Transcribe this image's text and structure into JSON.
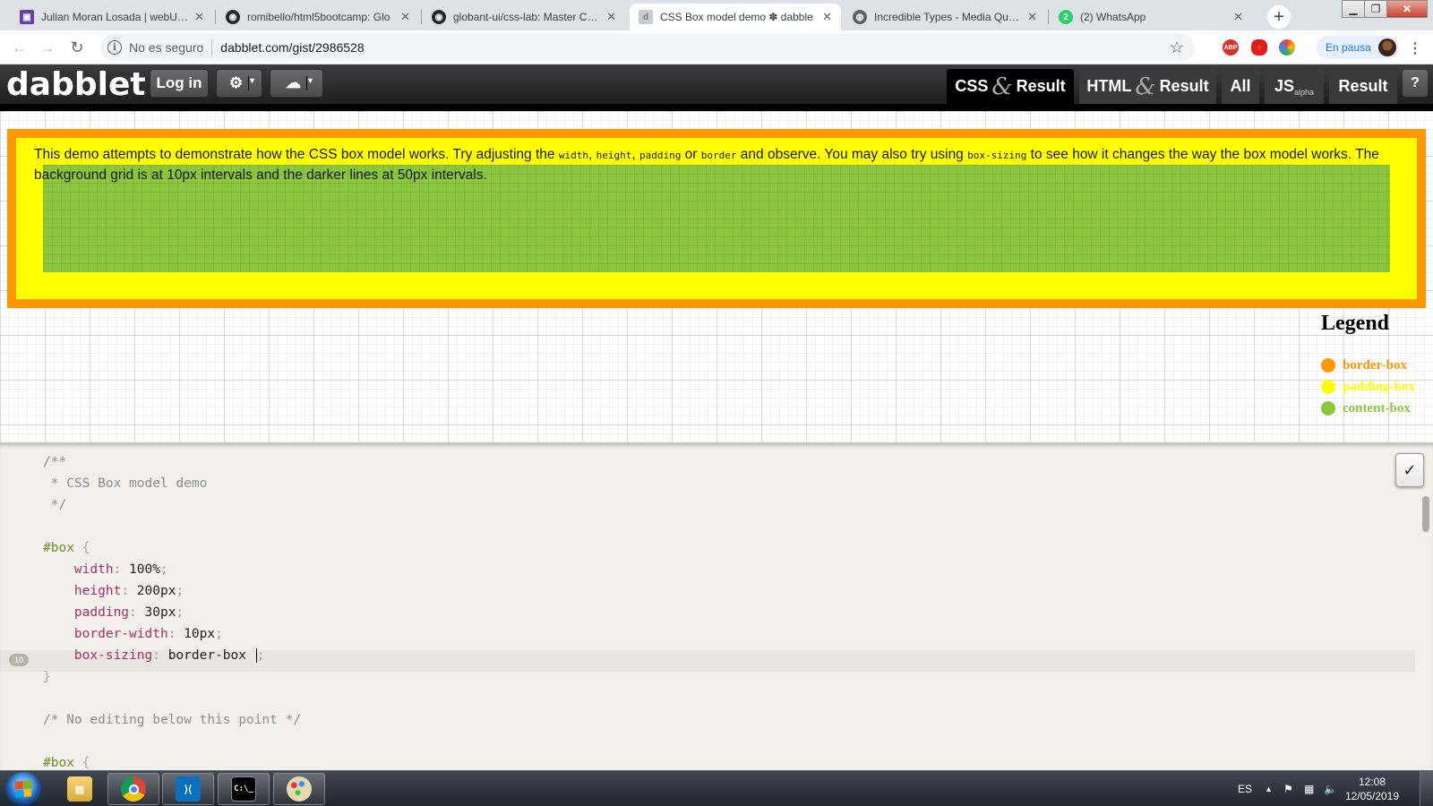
{
  "browser": {
    "tabs": [
      {
        "title": "Julian Moran Losada | webUIGL",
        "icon": "purple-square-icon"
      },
      {
        "title": "romibello/html5bootcamp: Glo",
        "icon": "github-icon"
      },
      {
        "title": "globant-ui/css-lab: Master CSS",
        "icon": "github-icon"
      },
      {
        "title": "CSS Box model demo ✽ dabble",
        "icon": "dabblet-icon"
      },
      {
        "title": "Incredible Types - Media Querie",
        "icon": "globe-icon"
      },
      {
        "title": "(2) WhatsApp",
        "icon": "whatsapp-icon"
      }
    ],
    "active_tab": 3,
    "security_label": "No es seguro",
    "url": "dabblet.com/gist/2986528",
    "profile_status": "En pausa",
    "extensions": [
      {
        "name": "adblock-plus-icon",
        "label": "ABP",
        "color": "#d9342b"
      },
      {
        "name": "opera-vpn-icon",
        "label": "",
        "color": "#e21b1b"
      },
      {
        "name": "color-picker-icon",
        "label": "",
        "color": "#f4a522"
      }
    ]
  },
  "dabblet": {
    "logo": "dabblet",
    "login_label": "Log in",
    "view_tabs": [
      {
        "main": "CSS",
        "amp": "&",
        "rest": "Result",
        "active": true
      },
      {
        "main": "HTML",
        "amp": "&",
        "rest": "Result",
        "active": false
      },
      {
        "main": "All",
        "amp": "",
        "rest": "",
        "active": false
      },
      {
        "main": "JS",
        "amp": "",
        "rest": "",
        "sub": "alpha",
        "active": false
      },
      {
        "main": "Result",
        "amp": "",
        "rest": "",
        "active": false
      }
    ],
    "help_label": "?"
  },
  "result": {
    "text": {
      "t1": "This demo attempts to demonstrate how the CSS box model works. Try adjusting the ",
      "c1": "width",
      "t2": ", ",
      "c2": "height",
      "t3": ", ",
      "c3": "padding",
      "t4": " or ",
      "c4": "border",
      "t5": " and observe. You may also try using ",
      "c5": "box-sizing",
      "t6": " to see how it changes the way the box model works. The background grid is at 10px intervals and the darker lines at 50px intervals."
    },
    "legend": {
      "title": "Legend",
      "items": [
        {
          "label": "border-box",
          "color": "#ff9800"
        },
        {
          "label": "padding-box",
          "color": "#ffff00"
        },
        {
          "label": "content-box",
          "color": "#8cc63f"
        }
      ]
    }
  },
  "editor": {
    "lines": {
      "l1": "/**",
      "l2": " * CSS Box model demo",
      "l3": " */",
      "l5_sel": "#box",
      "l5_brace": " {",
      "l6_prop": "width",
      "l6_val": "100%",
      "l7_prop": "height",
      "l7_val": "200px",
      "l8_prop": "padding",
      "l8_val": "30px",
      "l9_prop": "border-width",
      "l9_val": "10px",
      "l10_prop": "box-sizing",
      "l10_val": "border-box",
      "l11": "}",
      "l13": "/* No editing below this point */",
      "l15_sel": "#box",
      "l15_brace": " {"
    },
    "current_line_number": "10",
    "check_label": "✓"
  },
  "taskbar": {
    "apps": [
      {
        "name": "file-explorer-icon",
        "open": false
      },
      {
        "name": "chrome-icon",
        "open": true
      },
      {
        "name": "vscode-icon",
        "open": true
      },
      {
        "name": "cmd-icon",
        "open": true
      },
      {
        "name": "paint-icon",
        "open": true
      }
    ],
    "language": "ES",
    "time": "12:08",
    "date": "12/05/2019"
  }
}
